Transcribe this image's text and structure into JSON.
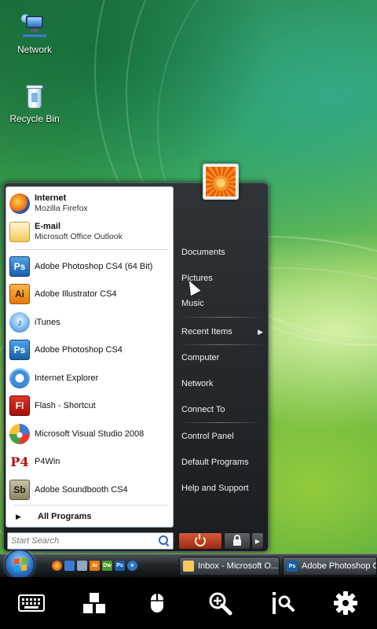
{
  "desktop": {
    "icons": [
      {
        "label": "Network",
        "icon": "network-icon"
      },
      {
        "label": "Recycle Bin",
        "icon": "recycle-bin-icon"
      }
    ]
  },
  "start_menu": {
    "pinned": [
      {
        "title": "Internet",
        "subtitle": "Mozilla Firefox",
        "icon": "firefox-icon"
      },
      {
        "title": "E-mail",
        "subtitle": "Microsoft Office Outlook",
        "icon": "outlook-icon"
      }
    ],
    "recent_programs": [
      {
        "label": "Adobe Photoshop CS4 (64 Bit)",
        "icon": "photoshop-icon",
        "glyph": "Ps"
      },
      {
        "label": "Adobe Illustrator CS4",
        "icon": "illustrator-icon",
        "glyph": "Ai"
      },
      {
        "label": "iTunes",
        "icon": "itunes-icon",
        "glyph": "♪"
      },
      {
        "label": "Adobe Photoshop CS4",
        "icon": "photoshop-icon",
        "glyph": "Ps"
      },
      {
        "label": "Internet Explorer",
        "icon": "internet-explorer-icon",
        "glyph": "e"
      },
      {
        "label": "Flash - Shortcut",
        "icon": "flash-icon",
        "glyph": "Fl"
      },
      {
        "label": "Microsoft Visual Studio 2008",
        "icon": "visual-studio-icon",
        "glyph": ""
      },
      {
        "label": "P4Win",
        "icon": "p4win-icon",
        "glyph": "P4"
      },
      {
        "label": "Adobe Soundbooth CS4",
        "icon": "soundbooth-icon",
        "glyph": "Sb"
      }
    ],
    "all_programs_label": "All Programs",
    "search_placeholder": "Start Search",
    "right_items": [
      {
        "label": "Documents"
      },
      {
        "label": "Pictures"
      },
      {
        "label": "Music"
      },
      {
        "label": "Recent Items",
        "submenu": true
      },
      {
        "label": "Computer"
      },
      {
        "label": "Network"
      },
      {
        "label": "Connect To"
      },
      {
        "label": "Control Panel"
      },
      {
        "label": "Default Programs"
      },
      {
        "label": "Help and Support"
      }
    ]
  },
  "taskbar": {
    "quick_launch": [
      {
        "icon": "firefox-icon",
        "glyph": "",
        "color": "#e86a12"
      },
      {
        "icon": "show-desktop-icon",
        "glyph": "",
        "color": "#3b7bd6"
      },
      {
        "icon": "window-switcher-icon",
        "glyph": "",
        "color": "#8fa7c0"
      },
      {
        "icon": "illustrator-icon",
        "glyph": "Ai",
        "color": "#e47a09"
      },
      {
        "icon": "dreamweaver-icon",
        "glyph": "Dw",
        "color": "#4a9a2c"
      },
      {
        "icon": "photoshop-icon",
        "glyph": "Ps",
        "color": "#1a5ea8"
      },
      {
        "icon": "internet-explorer-icon",
        "glyph": "e",
        "color": "#2a76c8"
      }
    ],
    "windows": [
      {
        "label": "Inbox - Microsoft O...",
        "icon": "outlook-icon",
        "color": "#f4c85a"
      },
      {
        "label": "Adobe Photoshop C...",
        "icon": "photoshop-icon",
        "color": "#1a5ea8"
      }
    ]
  },
  "remote_toolbar": [
    {
      "icon": "keyboard-icon"
    },
    {
      "icon": "apps-icon"
    },
    {
      "icon": "mouse-icon"
    },
    {
      "icon": "zoom-icon"
    },
    {
      "icon": "pointer-zoom-icon"
    },
    {
      "icon": "gear-icon"
    }
  ],
  "colors": {
    "menu_dark": "#1a1d20",
    "menu_light": "#ffffff",
    "accent_blue": "#2d72c6",
    "power_orange": "#d55a3a"
  }
}
